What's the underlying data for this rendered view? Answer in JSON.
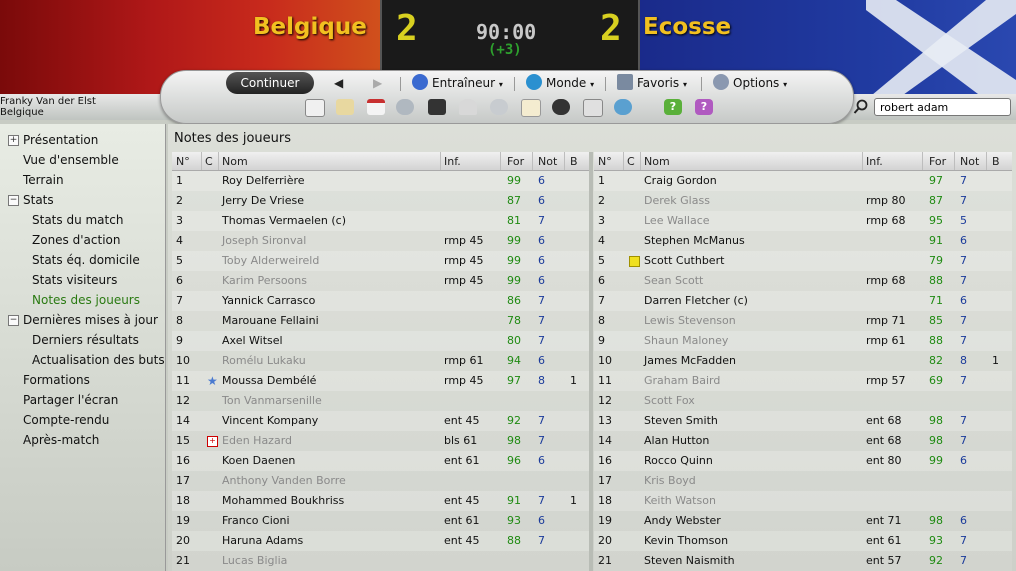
{
  "match": {
    "home_team": "Belgique",
    "away_team": "Ecosse",
    "home_score": "2",
    "away_score": "2",
    "clock": "90:00",
    "added_time": "(+3)"
  },
  "manager": {
    "name": "Franky Van der Elst",
    "team": "Belgique"
  },
  "toolbar": {
    "continue_label": "Continuer",
    "back_icon": "back-arrow-icon",
    "forward_icon": "forward-arrow-icon",
    "menus": [
      {
        "label": "Entraîneur",
        "icon": "manager-icon",
        "color": "#3a6ad0"
      },
      {
        "label": "Monde",
        "icon": "globe-icon",
        "color": "#2a90d0"
      },
      {
        "label": "Favoris",
        "icon": "folder-icon",
        "color": "#7a8aa0"
      },
      {
        "label": "Options",
        "icon": "gear-icon",
        "color": "#8a98b0"
      }
    ],
    "tools": [
      "home-icon",
      "ticket-icon",
      "calendar-icon",
      "people-icon",
      "tactics-board-icon",
      "trophy-icon",
      "search-players-icon",
      "notepad-icon",
      "binoculars-icon",
      "newspaper-icon",
      "world-icon",
      "help-icon",
      "info-icon"
    ]
  },
  "search": {
    "value": "robert adam",
    "icon": "magnifier-icon"
  },
  "sidebar": {
    "items": [
      {
        "label": "Présentation",
        "expander": "+",
        "indent": 0
      },
      {
        "label": "Vue d'ensemble",
        "expander": "",
        "indent": 0
      },
      {
        "label": "Terrain",
        "expander": "",
        "indent": 0
      },
      {
        "label": "Stats",
        "expander": "−",
        "indent": 0
      },
      {
        "label": "Stats du match",
        "expander": "",
        "indent": 1
      },
      {
        "label": "Zones d'action",
        "expander": "",
        "indent": 1
      },
      {
        "label": "Stats éq. domicile",
        "expander": "",
        "indent": 1
      },
      {
        "label": "Stats visiteurs",
        "expander": "",
        "indent": 1
      },
      {
        "label": "Notes des joueurs",
        "expander": "",
        "indent": 1,
        "active": true
      },
      {
        "label": "Dernières mises à jour",
        "expander": "−",
        "indent": 0
      },
      {
        "label": "Derniers résultats",
        "expander": "",
        "indent": 1
      },
      {
        "label": "Actualisation des buts",
        "expander": "",
        "indent": 1
      },
      {
        "label": "Formations",
        "expander": "",
        "indent": 0
      },
      {
        "label": "Partager l'écran",
        "expander": "",
        "indent": 0
      },
      {
        "label": "Compte-rendu",
        "expander": "",
        "indent": 0
      },
      {
        "label": "Après-match",
        "expander": "",
        "indent": 0
      }
    ]
  },
  "main": {
    "title": "Notes des joueurs",
    "columns": [
      "N°",
      "C",
      "Nom",
      "Inf.",
      "For",
      "Not",
      "B"
    ]
  },
  "home_players": [
    {
      "n": "1",
      "c": "",
      "name": "Roy Delferrière",
      "inf": "",
      "for": "99",
      "not": "6",
      "b": "",
      "sub": false
    },
    {
      "n": "2",
      "c": "",
      "name": "Jerry De Vriese",
      "inf": "",
      "for": "87",
      "not": "6",
      "b": "",
      "sub": false
    },
    {
      "n": "3",
      "c": "",
      "name": "Thomas Vermaelen (c)",
      "inf": "",
      "for": "81",
      "not": "7",
      "b": "",
      "sub": false
    },
    {
      "n": "4",
      "c": "",
      "name": "Joseph Sironval",
      "inf": "rmp 45",
      "for": "99",
      "not": "6",
      "b": "",
      "sub": true
    },
    {
      "n": "5",
      "c": "",
      "name": "Toby Alderweireld",
      "inf": "rmp 45",
      "for": "99",
      "not": "6",
      "b": "",
      "sub": true
    },
    {
      "n": "6",
      "c": "",
      "name": "Karim Persoons",
      "inf": "rmp 45",
      "for": "99",
      "not": "6",
      "b": "",
      "sub": true
    },
    {
      "n": "7",
      "c": "",
      "name": "Yannick Carrasco",
      "inf": "",
      "for": "86",
      "not": "7",
      "b": "",
      "sub": false
    },
    {
      "n": "8",
      "c": "",
      "name": "Marouane Fellaini",
      "inf": "",
      "for": "78",
      "not": "7",
      "b": "",
      "sub": false
    },
    {
      "n": "9",
      "c": "",
      "name": "Axel Witsel",
      "inf": "",
      "for": "80",
      "not": "7",
      "b": "",
      "sub": false
    },
    {
      "n": "10",
      "c": "",
      "name": "Romélu Lukaku",
      "inf": "rmp 61",
      "for": "94",
      "not": "6",
      "b": "",
      "sub": true
    },
    {
      "n": "11",
      "c": "star",
      "name": "Moussa Dembélé",
      "inf": "rmp 45",
      "for": "97",
      "not": "8",
      "b": "1",
      "sub": false
    },
    {
      "n": "12",
      "c": "",
      "name": "Ton Vanmarsenille",
      "inf": "",
      "for": "",
      "not": "",
      "b": "",
      "sub": true
    },
    {
      "n": "14",
      "c": "",
      "name": "Vincent Kompany",
      "inf": "ent 45",
      "for": "92",
      "not": "7",
      "b": "",
      "sub": false
    },
    {
      "n": "15",
      "c": "injury",
      "name": "Eden Hazard",
      "inf": "bls 61",
      "for": "98",
      "not": "7",
      "b": "",
      "sub": true
    },
    {
      "n": "16",
      "c": "",
      "name": "Koen Daenen",
      "inf": "ent 61",
      "for": "96",
      "not": "6",
      "b": "",
      "sub": false
    },
    {
      "n": "17",
      "c": "",
      "name": "Anthony Vanden Borre",
      "inf": "",
      "for": "",
      "not": "",
      "b": "",
      "sub": true
    },
    {
      "n": "18",
      "c": "",
      "name": "Mohammed Boukhriss",
      "inf": "ent 45",
      "for": "91",
      "not": "7",
      "b": "1",
      "sub": false
    },
    {
      "n": "19",
      "c": "",
      "name": "Franco Cioni",
      "inf": "ent 61",
      "for": "93",
      "not": "6",
      "b": "",
      "sub": false
    },
    {
      "n": "20",
      "c": "",
      "name": "Haruna Adams",
      "inf": "ent 45",
      "for": "88",
      "not": "7",
      "b": "",
      "sub": false
    },
    {
      "n": "21",
      "c": "",
      "name": "Lucas Biglia",
      "inf": "",
      "for": "",
      "not": "",
      "b": "",
      "sub": true
    }
  ],
  "away_players": [
    {
      "n": "1",
      "c": "",
      "name": "Craig Gordon",
      "inf": "",
      "for": "97",
      "not": "7",
      "b": "",
      "sub": false
    },
    {
      "n": "2",
      "c": "",
      "name": "Derek Glass",
      "inf": "rmp 80",
      "for": "87",
      "not": "7",
      "b": "",
      "sub": true
    },
    {
      "n": "3",
      "c": "",
      "name": "Lee Wallace",
      "inf": "rmp 68",
      "for": "95",
      "not": "5",
      "b": "",
      "sub": true
    },
    {
      "n": "4",
      "c": "",
      "name": "Stephen McManus",
      "inf": "",
      "for": "91",
      "not": "6",
      "b": "",
      "sub": false
    },
    {
      "n": "5",
      "c": "yellow",
      "name": "Scott Cuthbert",
      "inf": "",
      "for": "79",
      "not": "7",
      "b": "",
      "sub": false
    },
    {
      "n": "6",
      "c": "",
      "name": "Sean Scott",
      "inf": "rmp 68",
      "for": "88",
      "not": "7",
      "b": "",
      "sub": true
    },
    {
      "n": "7",
      "c": "",
      "name": "Darren Fletcher (c)",
      "inf": "",
      "for": "71",
      "not": "6",
      "b": "",
      "sub": false
    },
    {
      "n": "8",
      "c": "",
      "name": "Lewis Stevenson",
      "inf": "rmp 71",
      "for": "85",
      "not": "7",
      "b": "",
      "sub": true
    },
    {
      "n": "9",
      "c": "",
      "name": "Shaun Maloney",
      "inf": "rmp 61",
      "for": "88",
      "not": "7",
      "b": "",
      "sub": true
    },
    {
      "n": "10",
      "c": "",
      "name": "James McFadden",
      "inf": "",
      "for": "82",
      "not": "8",
      "b": "1",
      "sub": false
    },
    {
      "n": "11",
      "c": "",
      "name": "Graham Baird",
      "inf": "rmp 57",
      "for": "69",
      "not": "7",
      "b": "",
      "sub": true
    },
    {
      "n": "12",
      "c": "",
      "name": "Scott Fox",
      "inf": "",
      "for": "",
      "not": "",
      "b": "",
      "sub": true
    },
    {
      "n": "13",
      "c": "",
      "name": "Steven Smith",
      "inf": "ent 68",
      "for": "98",
      "not": "7",
      "b": "",
      "sub": false
    },
    {
      "n": "14",
      "c": "",
      "name": "Alan Hutton",
      "inf": "ent 68",
      "for": "98",
      "not": "7",
      "b": "",
      "sub": false
    },
    {
      "n": "16",
      "c": "",
      "name": "Rocco Quinn",
      "inf": "ent 80",
      "for": "99",
      "not": "6",
      "b": "",
      "sub": false
    },
    {
      "n": "17",
      "c": "",
      "name": "Kris Boyd",
      "inf": "",
      "for": "",
      "not": "",
      "b": "",
      "sub": true
    },
    {
      "n": "18",
      "c": "",
      "name": "Keith Watson",
      "inf": "",
      "for": "",
      "not": "",
      "b": "",
      "sub": true
    },
    {
      "n": "19",
      "c": "",
      "name": "Andy Webster",
      "inf": "ent 71",
      "for": "98",
      "not": "6",
      "b": "",
      "sub": false
    },
    {
      "n": "20",
      "c": "",
      "name": "Kevin Thomson",
      "inf": "ent 61",
      "for": "93",
      "not": "7",
      "b": "",
      "sub": false
    },
    {
      "n": "21",
      "c": "",
      "name": "Steven Naismith",
      "inf": "ent 57",
      "for": "92",
      "not": "7",
      "b": "",
      "sub": false
    }
  ]
}
